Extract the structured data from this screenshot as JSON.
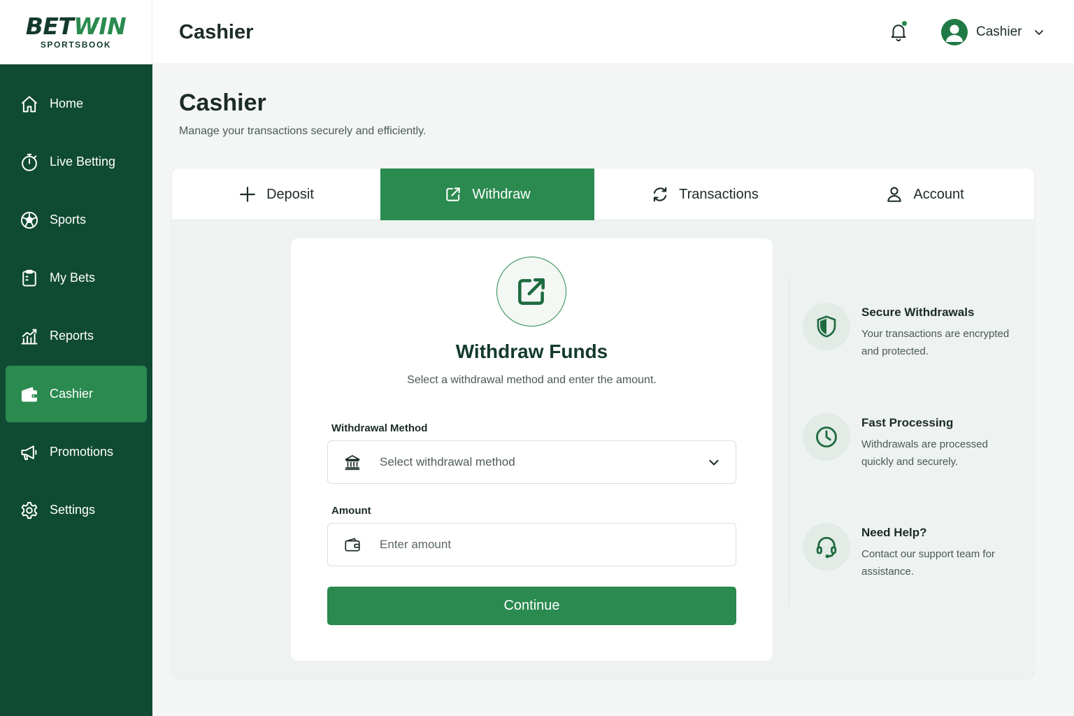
{
  "brand": {
    "name_part1": "BET",
    "name_part2": "WIN",
    "tagline": "SPORTSBOOK"
  },
  "sidebar": {
    "items": [
      {
        "label": "Home",
        "icon": "home-icon"
      },
      {
        "label": "Live Betting",
        "icon": "stopwatch-icon"
      },
      {
        "label": "Sports",
        "icon": "soccer-ball-icon"
      },
      {
        "label": "My Bets",
        "icon": "clipboard-icon"
      },
      {
        "label": "Reports",
        "icon": "chart-icon"
      },
      {
        "label": "Cashier",
        "icon": "wallet-icon",
        "active": true
      },
      {
        "label": "Promotions",
        "icon": "megaphone-icon"
      },
      {
        "label": "Settings",
        "icon": "gear-icon"
      }
    ]
  },
  "topbar": {
    "title": "Cashier",
    "user_label": "Cashier",
    "notification_icon": "bell-icon"
  },
  "page": {
    "title": "Cashier",
    "subtitle": "Manage your transactions securely and efficiently."
  },
  "tabs": [
    {
      "label": "Deposit",
      "icon": "plus-icon"
    },
    {
      "label": "Withdraw",
      "icon": "external-link-icon",
      "active": true
    },
    {
      "label": "Transactions",
      "icon": "refresh-icon"
    },
    {
      "label": "Account",
      "icon": "user-icon"
    }
  ],
  "form": {
    "title": "Withdraw Funds",
    "subtitle": "Select a withdrawal method and enter the amount.",
    "method_label": "Withdrawal Method",
    "method_placeholder": "Select withdrawal method",
    "amount_label": "Amount",
    "amount_placeholder": "Enter amount",
    "submit_label": "Continue"
  },
  "info": [
    {
      "title": "Secure Withdrawals",
      "text": "Your transactions are encrypted and protected.",
      "icon": "shield-icon"
    },
    {
      "title": "Fast Processing",
      "text": "Withdrawals are processed quickly and securely.",
      "icon": "clock-icon"
    },
    {
      "title": "Need Help?",
      "text": "Contact our support team for assistance.",
      "icon": "headset-icon"
    }
  ],
  "colors": {
    "sidebar_bg": "#0f4a33",
    "accent": "#2a8a4f",
    "dark_text": "#143a2b",
    "page_bg": "#f4f6f5"
  }
}
